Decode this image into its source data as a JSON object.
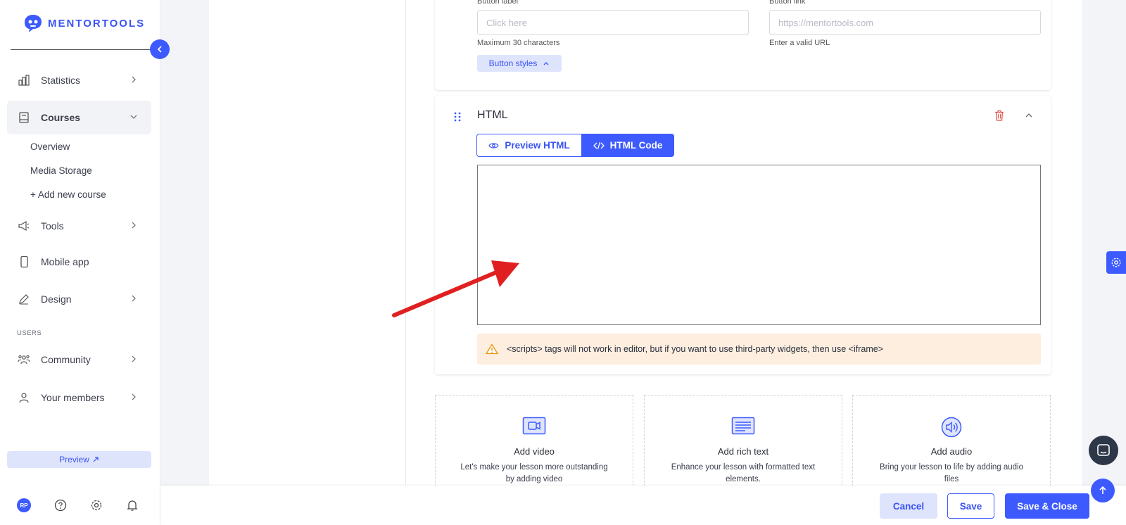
{
  "brand": {
    "name": "MENTORTOOLS",
    "accent": "#3d5afe"
  },
  "sidebar": {
    "items": [
      {
        "label": "Statistics",
        "icon": "bar-chart-icon"
      },
      {
        "label": "Courses",
        "icon": "book-icon"
      },
      {
        "label": "Tools",
        "icon": "megaphone-icon"
      },
      {
        "label": "Mobile app",
        "icon": "phone-icon"
      },
      {
        "label": "Design",
        "icon": "pencil-icon"
      },
      {
        "label": "Community",
        "icon": "community-icon"
      },
      {
        "label": "Your members",
        "icon": "user-icon"
      }
    ],
    "courses_sub": [
      "Overview",
      "Media Storage",
      "+ Add new course"
    ],
    "users_section": "USERS",
    "preview_label": "Preview",
    "avatar_initials": "RP"
  },
  "button_block": {
    "label_title": "Button label",
    "label_placeholder": "Click here",
    "label_hint": "Maximum 30 characters",
    "link_title": "Button link",
    "link_placeholder": "https://mentortools.com",
    "link_hint": "Enter a valid URL",
    "styles_label": "Button styles"
  },
  "html_block": {
    "title": "HTML",
    "tab_preview": "Preview HTML",
    "tab_code": "HTML Code",
    "warning": "<scripts> tags will not work in editor, but if you want to use third-party widgets, then use <iframe>"
  },
  "add_blocks": [
    {
      "title": "Add video",
      "desc": "Let's make your lesson more outstanding by adding video"
    },
    {
      "title": "Add rich text",
      "desc": "Enhance your lesson with formatted text elements."
    },
    {
      "title": "Add audio",
      "desc": "Bring your lesson to life by adding audio files"
    }
  ],
  "footer": {
    "cancel": "Cancel",
    "save": "Save",
    "save_close": "Save & Close"
  }
}
